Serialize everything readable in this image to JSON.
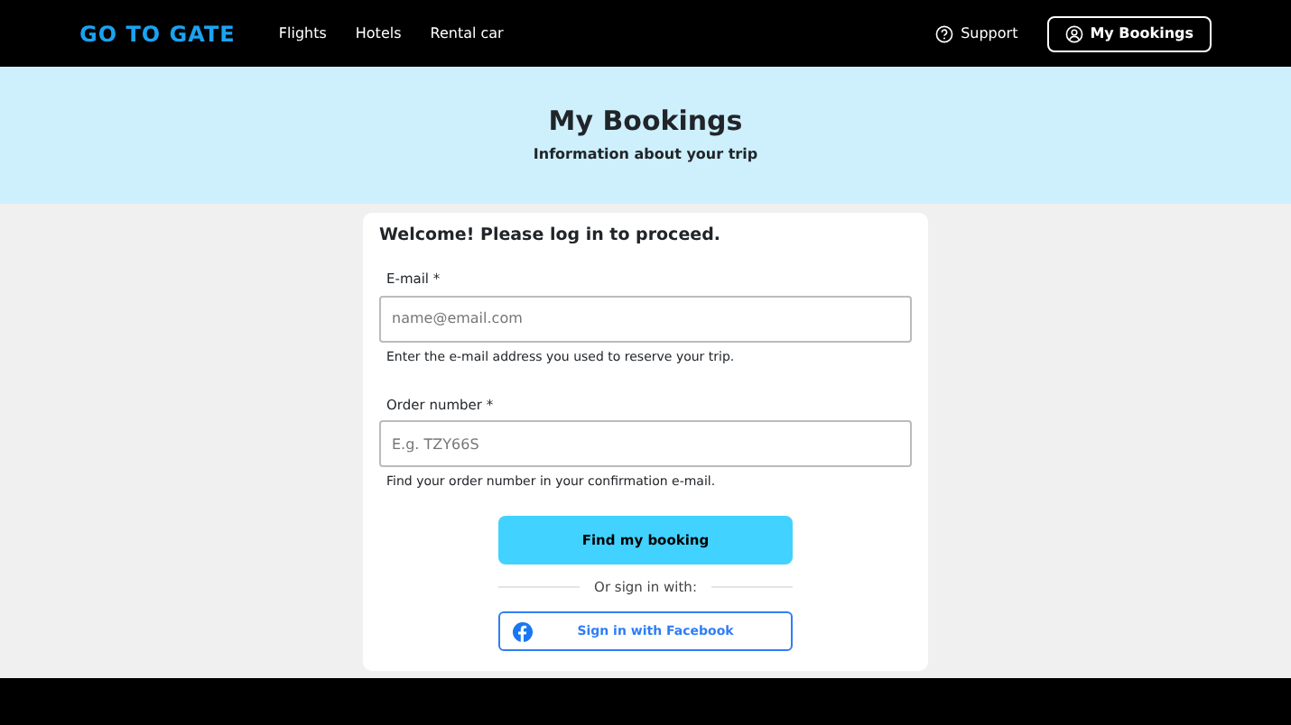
{
  "header": {
    "logo": "GO TO GATE",
    "nav": [
      "Flights",
      "Hotels",
      "Rental car"
    ],
    "support": "Support",
    "my_bookings": "My Bookings"
  },
  "hero": {
    "title": "My Bookings",
    "subtitle": "Information about your trip"
  },
  "form": {
    "heading": "Welcome! Please log in to proceed.",
    "fields": [
      {
        "label": "E-mail *",
        "placeholder": "name@email.com",
        "help": "Enter the e-mail address you used to reserve your trip."
      },
      {
        "label": "Order number *",
        "placeholder": "E.g. TZY66S",
        "help": "Find your order number in your confirmation e-mail."
      }
    ],
    "submit": "Find my booking",
    "divider": "Or sign in with:",
    "facebook": "Sign in with Facebook"
  }
}
